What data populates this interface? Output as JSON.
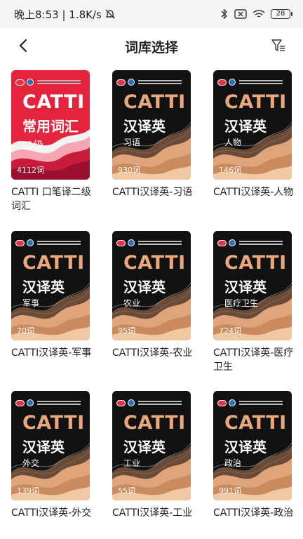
{
  "status": {
    "time_speed": "晚上8:53 | 1.8K/s",
    "battery": "28"
  },
  "header": {
    "title": "词库选择"
  },
  "books": [
    {
      "cover_main": "CATTI",
      "cover_sub": "常用词汇",
      "cover_topic": "二级",
      "count": "4112词",
      "title": "CATTI 口笔译二级词汇",
      "theme": "red"
    },
    {
      "cover_main": "CATTI",
      "cover_sub": "汉译英",
      "cover_topic": "习语",
      "count": "930词",
      "title": "CATTI汉译英-习语",
      "theme": "gold"
    },
    {
      "cover_main": "CATTI",
      "cover_sub": "汉译英",
      "cover_topic": "人物",
      "count": "146词",
      "title": "CATTI汉译英-人物",
      "theme": "gold"
    },
    {
      "cover_main": "CATTI",
      "cover_sub": "汉译英",
      "cover_topic": "军事",
      "count": "70词",
      "title": "CATTI汉译英-军事",
      "theme": "gold"
    },
    {
      "cover_main": "CATTI",
      "cover_sub": "汉译英",
      "cover_topic": "农业",
      "count": "95词",
      "title": "CATTI汉译英-农业",
      "theme": "gold"
    },
    {
      "cover_main": "CATTI",
      "cover_sub": "汉译英",
      "cover_topic": "医疗卫生",
      "count": "724词",
      "title": "CATTI汉译英-医疗卫生",
      "theme": "gold"
    },
    {
      "cover_main": "CATTI",
      "cover_sub": "汉译英",
      "cover_topic": "外交",
      "count": "139词",
      "title": "CATTI汉译英-外交",
      "theme": "gold"
    },
    {
      "cover_main": "CATTI",
      "cover_sub": "汉译英",
      "cover_topic": "工业",
      "count": "55词",
      "title": "CATTI汉译英-工业",
      "theme": "gold"
    },
    {
      "cover_main": "CATTI",
      "cover_sub": "汉译英",
      "cover_topic": "政治",
      "count": "991词",
      "title": "CATTI汉译英-政治",
      "theme": "gold"
    }
  ],
  "colors": {
    "red_cover_bg": "#e4243c",
    "gold_wave": "#e0a47a",
    "cover_dark": "#111111"
  }
}
